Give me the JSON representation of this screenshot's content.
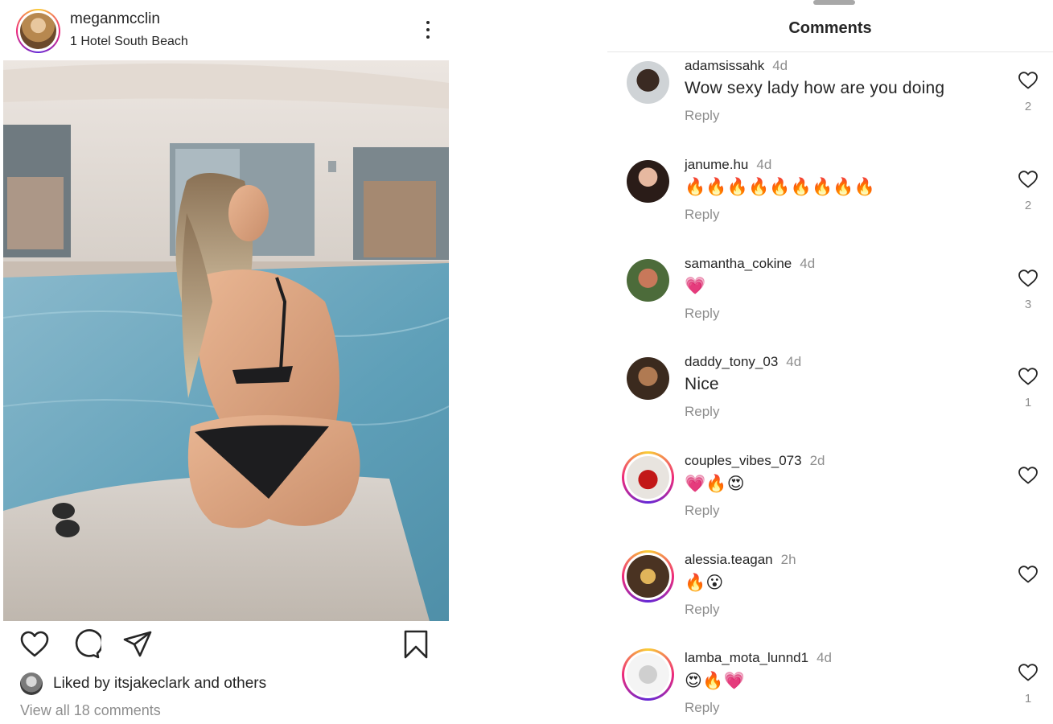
{
  "post": {
    "username": "meganmcclin",
    "location": "1 Hotel South Beach",
    "liked_by": "Liked by itsjakeclark and others",
    "view_all": "View all 18 comments"
  },
  "panel": {
    "title": "Comments"
  },
  "comments": [
    {
      "user": "adamsissahk",
      "time": "4d",
      "text": "Wow sexy lady how are you doing",
      "reply": "Reply",
      "likes": "2"
    },
    {
      "user": "janume.hu",
      "time": "4d",
      "text": "🔥🔥🔥🔥🔥🔥🔥🔥🔥",
      "reply": "Reply",
      "likes": "2"
    },
    {
      "user": "samantha_cokine",
      "time": "4d",
      "text": "💗",
      "reply": "Reply",
      "likes": "3"
    },
    {
      "user": "daddy_tony_03",
      "time": "4d",
      "text": "Nice",
      "reply": "Reply",
      "likes": "1"
    },
    {
      "user": "couples_vibes_073",
      "time": "2d",
      "text": "💗🔥😍",
      "reply": "Reply",
      "likes": ""
    },
    {
      "user": "alessia.teagan",
      "time": "2h",
      "text": "🔥😮",
      "reply": "Reply",
      "likes": ""
    },
    {
      "user": "lamba_mota_lunnd1",
      "time": "4d",
      "text": "😍🔥💗",
      "reply": "Reply",
      "likes": "1"
    }
  ],
  "colors": {
    "text": "#262626",
    "muted": "#8e8e8e",
    "story_ring_start": "#f9ce34",
    "story_ring_mid": "#ee2a7b",
    "story_ring_end": "#6228d7"
  },
  "icons": {
    "more": "vertical-dots-icon",
    "like": "heart-outline-icon",
    "comment": "speech-bubble-icon",
    "share": "paper-plane-icon",
    "save": "bookmark-icon"
  }
}
